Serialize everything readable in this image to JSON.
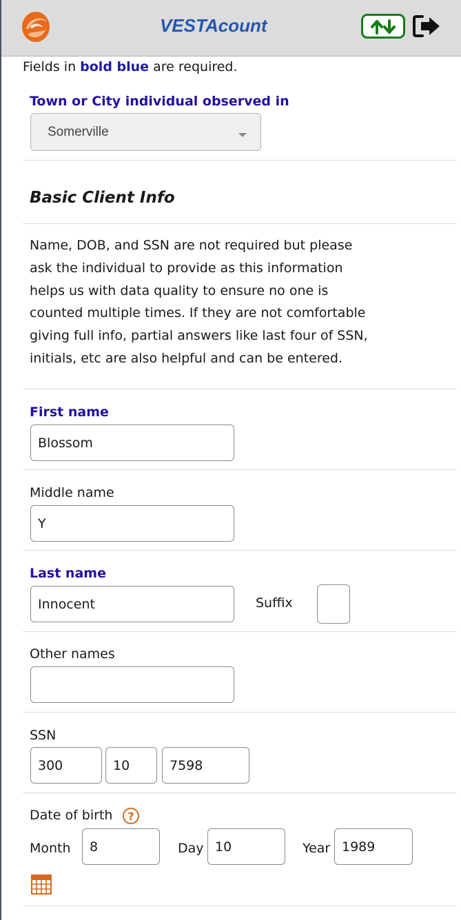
{
  "header": {
    "title": "VESTAcount",
    "logo_icon": "swirl-logo-icon",
    "sync_icon": "up-down-arrows-icon",
    "logout_icon": "logout-arrow-icon",
    "accent_color": "#2556b0",
    "sync_color": "#1a7a1a"
  },
  "hint": {
    "prefix": "Fields in ",
    "bold": "bold blue",
    "suffix": " are required."
  },
  "town": {
    "label": "Town or City individual observed in",
    "value": "Somerville"
  },
  "section": {
    "title": "Basic Client Info",
    "description_lines": [
      "Name, DOB, and SSN are not required but please",
      "ask the individual to provide as this information",
      "helps us with data quality to ensure no one is",
      "counted multiple times. If they are not comfortable",
      "giving full info, partial answers like last four of SSN,",
      "initials, etc are also helpful and can be entered."
    ]
  },
  "first_name": {
    "label": "First name",
    "value": "Blossom"
  },
  "middle_name": {
    "label": "Middle name",
    "value": "Y"
  },
  "last_name": {
    "label": "Last name",
    "value": "Innocent"
  },
  "suffix": {
    "label": "Suffix",
    "value": ""
  },
  "other_names": {
    "label": "Other names",
    "value": ""
  },
  "ssn": {
    "label": "SSN",
    "part1": "300",
    "part2": "10",
    "part3": "7598"
  },
  "dob": {
    "label": "Date of birth",
    "help_icon": "question-circle-icon",
    "month_label": "Month",
    "month": "8",
    "day_label": "Day",
    "day": "10",
    "year_label": "Year",
    "year": "1989",
    "calendar_icon": "calendar-icon",
    "icon_color": "#d4691e"
  }
}
